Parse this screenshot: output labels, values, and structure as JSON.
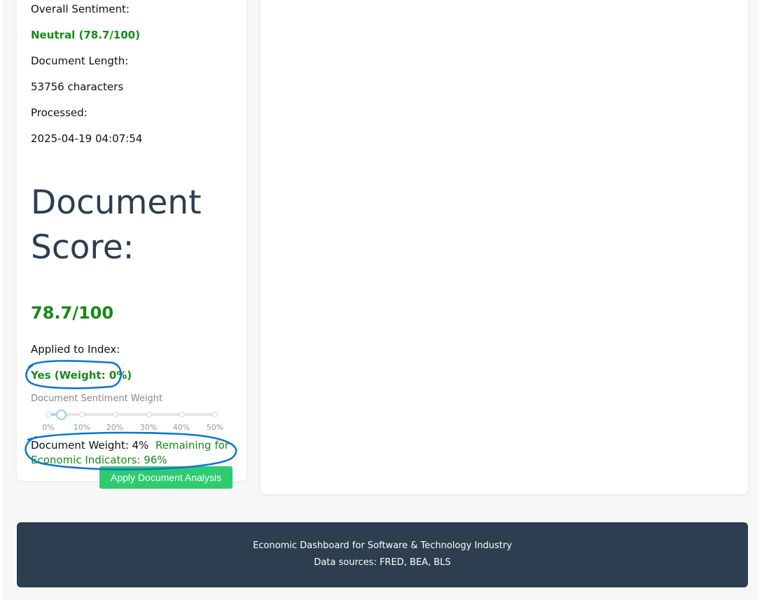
{
  "sentiment": {
    "overall_label": "Overall Sentiment:",
    "overall_value": "Neutral (78.7/100)",
    "length_label": "Document Length:",
    "length_value": "53756 characters",
    "processed_label": "Processed:",
    "processed_value": "2025-04-19 04:07:54"
  },
  "score": {
    "heading_line1": "Document",
    "heading_line2": "Score:",
    "value": "78.7/100"
  },
  "index": {
    "applied_label": "Applied to Index:",
    "applied_value": "Yes (Weight: 0%)"
  },
  "slider": {
    "label": "Document Sentiment Weight",
    "value_percent": 4,
    "ticks": [
      "0%",
      "10%",
      "20%",
      "30%",
      "40%",
      "50%"
    ]
  },
  "weight": {
    "doc_weight": "Document Weight: 4%",
    "remaining": "Remaining for Economic Indicators: 96%"
  },
  "apply_button": "Apply Document Analysis",
  "footer": {
    "line1": "Economic Dashboard for Software & Technology Industry",
    "line2": "Data sources: FRED, BEA, BLS"
  },
  "colors": {
    "accent_green": "#158a15",
    "button_green": "#2ecc71",
    "footer_bg": "#2c3e50",
    "annotation_blue": "#0b72d8"
  }
}
